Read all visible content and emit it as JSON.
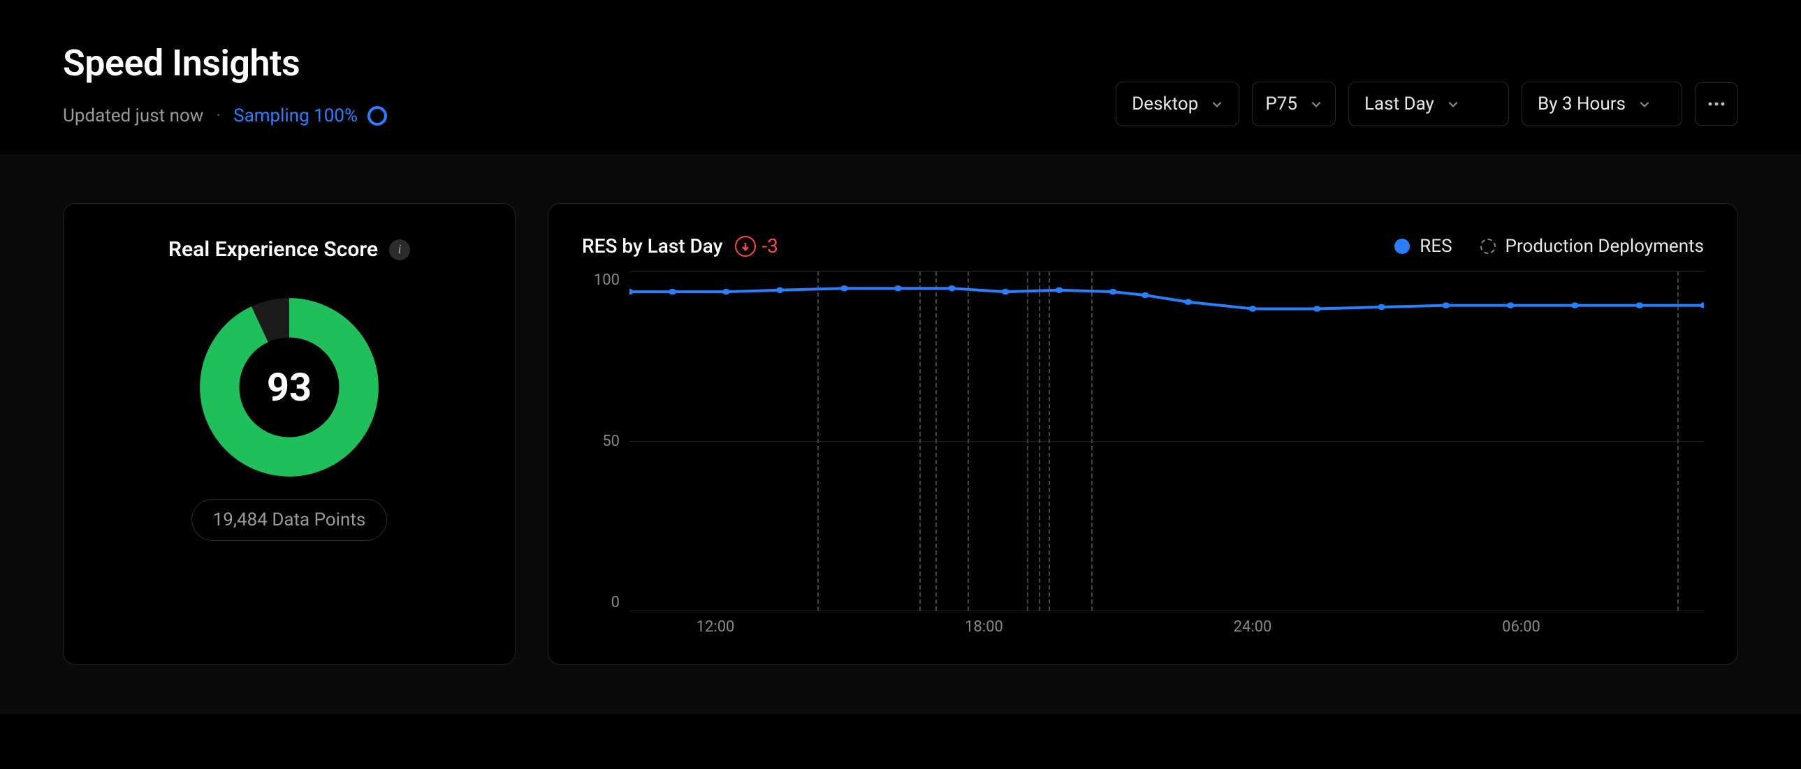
{
  "header": {
    "title": "Speed Insights",
    "updated": "Updated just now",
    "sampling": "Sampling 100%"
  },
  "controls": {
    "device": "Desktop",
    "percentile": "P75",
    "range": "Last Day",
    "bucket": "By 3 Hours"
  },
  "score_card": {
    "title": "Real Experience Score",
    "value": "93",
    "data_points": "19,484 Data Points"
  },
  "chart": {
    "title": "RES by Last Day",
    "delta": "-3",
    "legend": {
      "res": "RES",
      "deploys": "Production Deployments"
    }
  },
  "chart_data": {
    "type": "line",
    "title": "RES by Last Day",
    "ylabel": "",
    "xlabel": "",
    "ylim": [
      0,
      100
    ],
    "y_ticks": [
      0,
      50,
      100
    ],
    "x_ticks": [
      "12:00",
      "18:00",
      "24:00",
      "06:00"
    ],
    "x_tick_positions": [
      0.08,
      0.33,
      0.58,
      0.83
    ],
    "series": [
      {
        "name": "RES",
        "color": "#2a7fff",
        "points": [
          {
            "x": 0.0,
            "y": 94
          },
          {
            "x": 0.04,
            "y": 94
          },
          {
            "x": 0.09,
            "y": 94
          },
          {
            "x": 0.14,
            "y": 94.5
          },
          {
            "x": 0.2,
            "y": 95
          },
          {
            "x": 0.25,
            "y": 95
          },
          {
            "x": 0.3,
            "y": 95
          },
          {
            "x": 0.35,
            "y": 94
          },
          {
            "x": 0.4,
            "y": 94.5
          },
          {
            "x": 0.45,
            "y": 94
          },
          {
            "x": 0.48,
            "y": 93
          },
          {
            "x": 0.52,
            "y": 91
          },
          {
            "x": 0.58,
            "y": 89
          },
          {
            "x": 0.64,
            "y": 89
          },
          {
            "x": 0.7,
            "y": 89.5
          },
          {
            "x": 0.76,
            "y": 90
          },
          {
            "x": 0.82,
            "y": 90
          },
          {
            "x": 0.88,
            "y": 90
          },
          {
            "x": 0.94,
            "y": 90
          },
          {
            "x": 1.0,
            "y": 90
          }
        ]
      }
    ],
    "deployments_x": [
      0.175,
      0.27,
      0.285,
      0.315,
      0.37,
      0.381,
      0.39,
      0.43,
      0.975
    ]
  }
}
